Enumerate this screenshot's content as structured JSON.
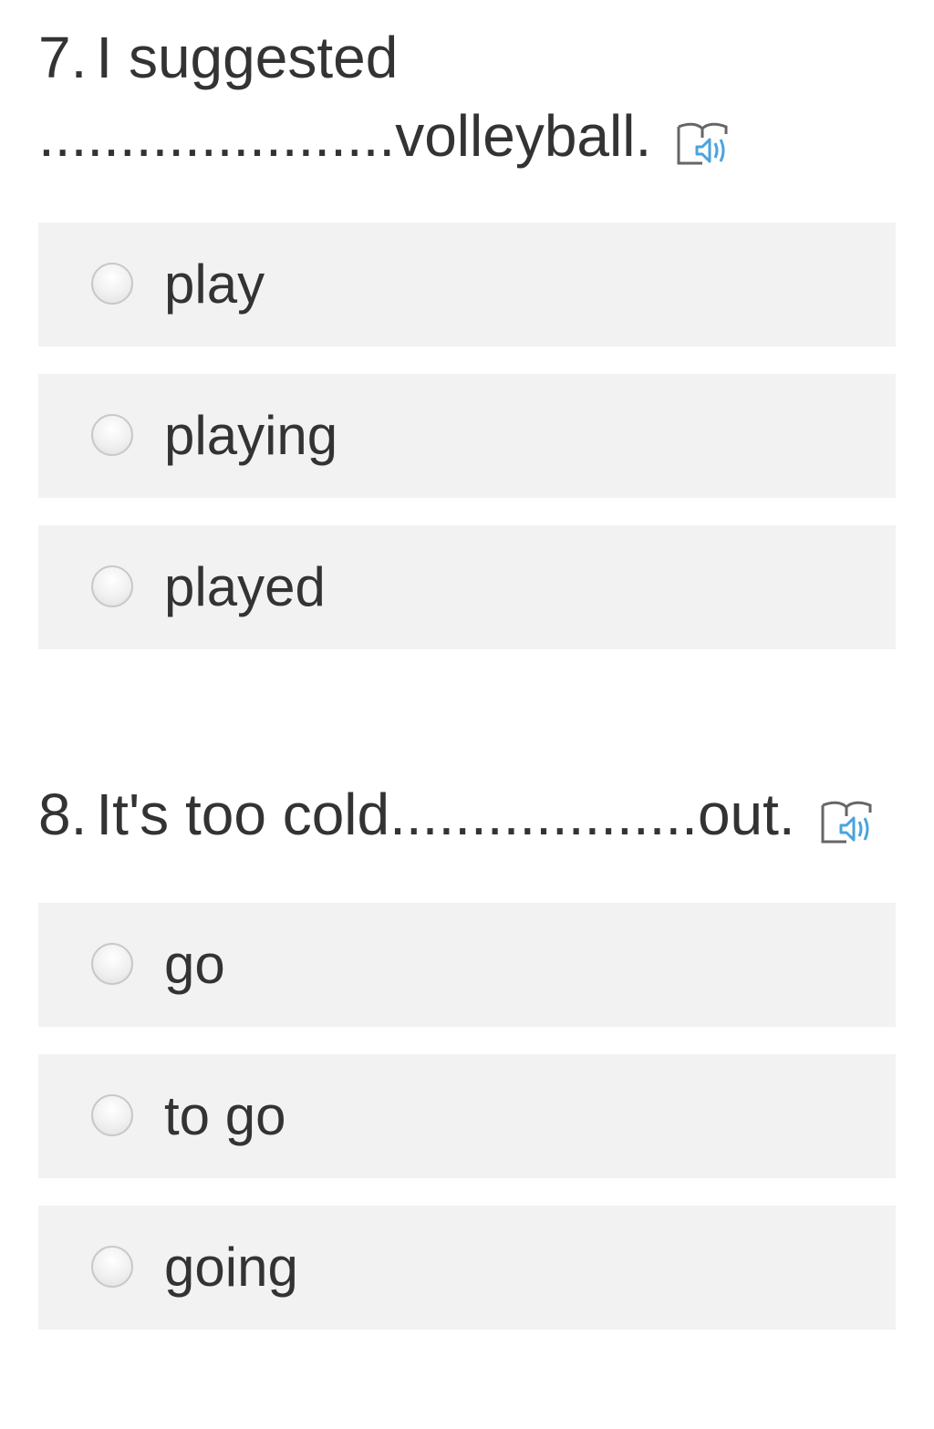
{
  "questions": [
    {
      "number": "7.",
      "text": "I suggested ......................volleyball.",
      "audio_icon": "audio-book-icon",
      "options": [
        {
          "label": "play"
        },
        {
          "label": "playing"
        },
        {
          "label": "played"
        }
      ]
    },
    {
      "number": "8.",
      "text": "It's too cold...................out.",
      "audio_icon": "audio-book-icon",
      "options": [
        {
          "label": "go"
        },
        {
          "label": "to go"
        },
        {
          "label": "going"
        }
      ]
    }
  ],
  "colors": {
    "text": "#333333",
    "option_background": "#f2f2f2",
    "radio_border": "#c8c8c8",
    "audio_accent": "#4aa3df",
    "audio_outline": "#666666"
  }
}
